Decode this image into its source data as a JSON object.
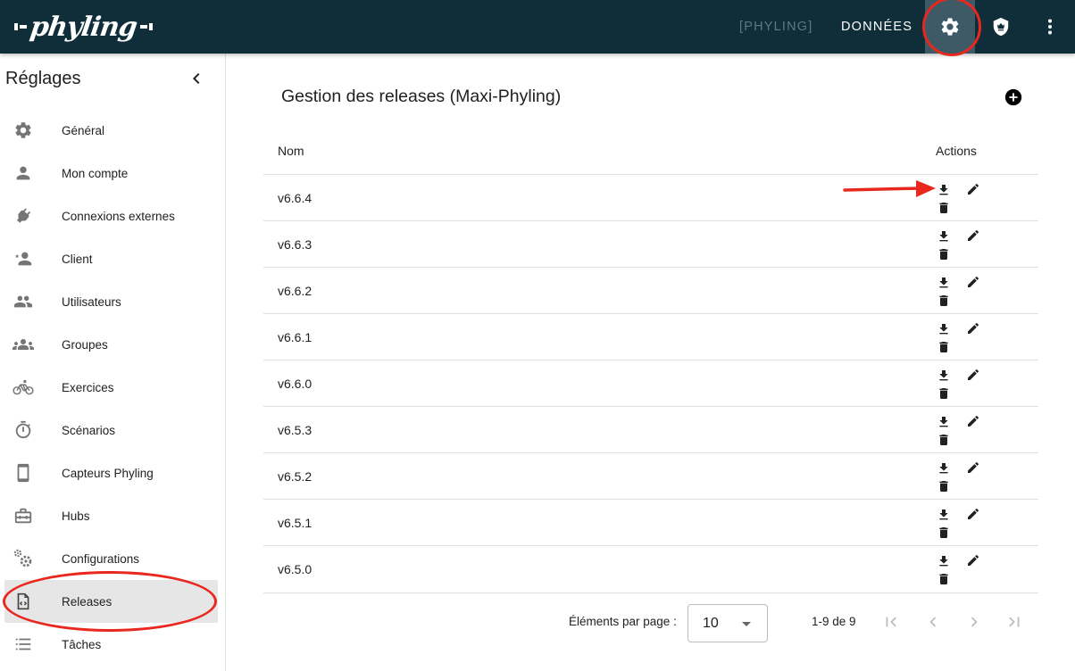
{
  "topbar": {
    "logo_text": "phyling",
    "nav_phyling": "[PHYLING]",
    "nav_donnees": "DONNÉES",
    "settings_icon": "gear-icon",
    "shield_icon": "shield-crown-icon",
    "more_icon": "more-vert-icon",
    "bg_color": "#0f2e3a"
  },
  "sidebar": {
    "title": "Réglages",
    "collapse_icon": "chevron-left-icon",
    "items": [
      {
        "label": "Général",
        "icon": "gear-icon"
      },
      {
        "label": "Mon compte",
        "icon": "person-icon"
      },
      {
        "label": "Connexions externes",
        "icon": "plug-icon"
      },
      {
        "label": "Client",
        "icon": "person-star-icon"
      },
      {
        "label": "Utilisateurs",
        "icon": "people-icon"
      },
      {
        "label": "Groupes",
        "icon": "groups-icon"
      },
      {
        "label": "Exercices",
        "icon": "bike-icon"
      },
      {
        "label": "Scénarios",
        "icon": "timer-icon"
      },
      {
        "label": "Capteurs Phyling",
        "icon": "phone-icon"
      },
      {
        "label": "Hubs",
        "icon": "case-icon"
      },
      {
        "label": "Configurations",
        "icon": "gears-icon"
      },
      {
        "label": "Releases",
        "icon": "code-file-icon",
        "active": true
      },
      {
        "label": "Tâches",
        "icon": "list-icon"
      }
    ]
  },
  "main": {
    "title": "Gestion des releases (Maxi-Phyling)",
    "add_icon": "add-circle-icon",
    "table": {
      "col_name": "Nom",
      "col_actions": "Actions",
      "rows": [
        "v6.6.4",
        "v6.6.3",
        "v6.6.2",
        "v6.6.1",
        "v6.6.0",
        "v6.5.3",
        "v6.5.2",
        "v6.5.1",
        "v6.5.0"
      ]
    },
    "paginator": {
      "label": "Éléments par page :",
      "page_size": "10",
      "range": "1-9 de 9"
    }
  },
  "annotation_color": "#e8281f"
}
